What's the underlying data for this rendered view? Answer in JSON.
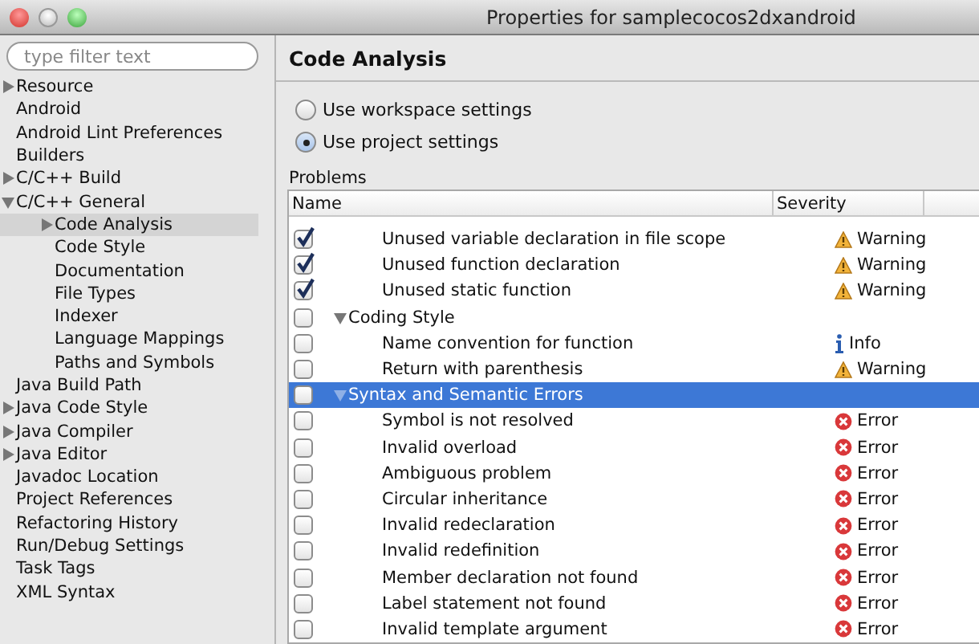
{
  "window": {
    "title": "Properties for samplecocos2dxandroid"
  },
  "filter": {
    "placeholder": "type filter text"
  },
  "sidebar": {
    "items": [
      {
        "label": "Resource",
        "expanded": false,
        "selected": false
      },
      {
        "label": "Android",
        "selected": false
      },
      {
        "label": "Android Lint Preferences",
        "selected": false
      },
      {
        "label": "Builders",
        "selected": false
      },
      {
        "label": "C/C++ Build",
        "expanded": false,
        "selected": false
      },
      {
        "label": "C/C++ General",
        "expanded": true,
        "selected": false,
        "children": [
          {
            "label": "Code Analysis",
            "expanded": false,
            "selected": true
          },
          {
            "label": "Code Style",
            "selected": false
          },
          {
            "label": "Documentation",
            "selected": false
          },
          {
            "label": "File Types",
            "selected": false
          },
          {
            "label": "Indexer",
            "selected": false
          },
          {
            "label": "Language Mappings",
            "selected": false
          },
          {
            "label": "Paths and Symbols",
            "selected": false
          }
        ]
      },
      {
        "label": "Java Build Path",
        "selected": false
      },
      {
        "label": "Java Code Style",
        "expanded": false,
        "selected": false
      },
      {
        "label": "Java Compiler",
        "expanded": false,
        "selected": false
      },
      {
        "label": "Java Editor",
        "expanded": false,
        "selected": false
      },
      {
        "label": "Javadoc Location",
        "selected": false
      },
      {
        "label": "Project References",
        "selected": false
      },
      {
        "label": "Refactoring History",
        "selected": false
      },
      {
        "label": "Run/Debug Settings",
        "selected": false
      },
      {
        "label": "Task Tags",
        "selected": false
      },
      {
        "label": "XML Syntax",
        "selected": false
      }
    ]
  },
  "page": {
    "title": "Code Analysis",
    "options": [
      {
        "label": "Use workspace settings",
        "selected": false
      },
      {
        "label": "Use project settings",
        "selected": true
      }
    ],
    "problems_label": "Problems",
    "table": {
      "columns": [
        "Name",
        "Severity"
      ],
      "rows": [
        {
          "kind": "problem",
          "checked": true,
          "selected": false,
          "name": "Unused variable declaration in file scope",
          "severity": {
            "kind": "warning",
            "label": "Warning"
          }
        },
        {
          "kind": "problem",
          "checked": true,
          "selected": false,
          "name": "Unused function declaration",
          "severity": {
            "kind": "warning",
            "label": "Warning"
          }
        },
        {
          "kind": "problem",
          "checked": true,
          "selected": false,
          "name": "Unused static function",
          "severity": {
            "kind": "warning",
            "label": "Warning"
          }
        },
        {
          "kind": "category",
          "checked": false,
          "selected": false,
          "expanded": true,
          "name": "Coding Style"
        },
        {
          "kind": "problem",
          "checked": false,
          "selected": false,
          "name": "Name convention for function",
          "severity": {
            "kind": "info",
            "label": "Info"
          }
        },
        {
          "kind": "problem",
          "checked": false,
          "selected": false,
          "name": "Return with parenthesis",
          "severity": {
            "kind": "warning",
            "label": "Warning"
          }
        },
        {
          "kind": "category",
          "checked": false,
          "selected": true,
          "expanded": true,
          "name": "Syntax and Semantic Errors"
        },
        {
          "kind": "problem",
          "checked": false,
          "selected": false,
          "name": "Symbol is not resolved",
          "severity": {
            "kind": "error",
            "label": "Error"
          }
        },
        {
          "kind": "problem",
          "checked": false,
          "selected": false,
          "name": "Invalid overload",
          "severity": {
            "kind": "error",
            "label": "Error"
          }
        },
        {
          "kind": "problem",
          "checked": false,
          "selected": false,
          "name": "Ambiguous problem",
          "severity": {
            "kind": "error",
            "label": "Error"
          }
        },
        {
          "kind": "problem",
          "checked": false,
          "selected": false,
          "name": "Circular inheritance",
          "severity": {
            "kind": "error",
            "label": "Error"
          }
        },
        {
          "kind": "problem",
          "checked": false,
          "selected": false,
          "name": "Invalid redeclaration",
          "severity": {
            "kind": "error",
            "label": "Error"
          }
        },
        {
          "kind": "problem",
          "checked": false,
          "selected": false,
          "name": "Invalid redefinition",
          "severity": {
            "kind": "error",
            "label": "Error"
          }
        },
        {
          "kind": "problem",
          "checked": false,
          "selected": false,
          "name": "Member declaration not found",
          "severity": {
            "kind": "error",
            "label": "Error"
          }
        },
        {
          "kind": "problem",
          "checked": false,
          "selected": false,
          "name": "Label statement not found",
          "severity": {
            "kind": "error",
            "label": "Error"
          }
        },
        {
          "kind": "problem",
          "checked": false,
          "selected": false,
          "name": "Invalid template argument",
          "severity": {
            "kind": "error",
            "label": "Error"
          }
        }
      ]
    }
  }
}
